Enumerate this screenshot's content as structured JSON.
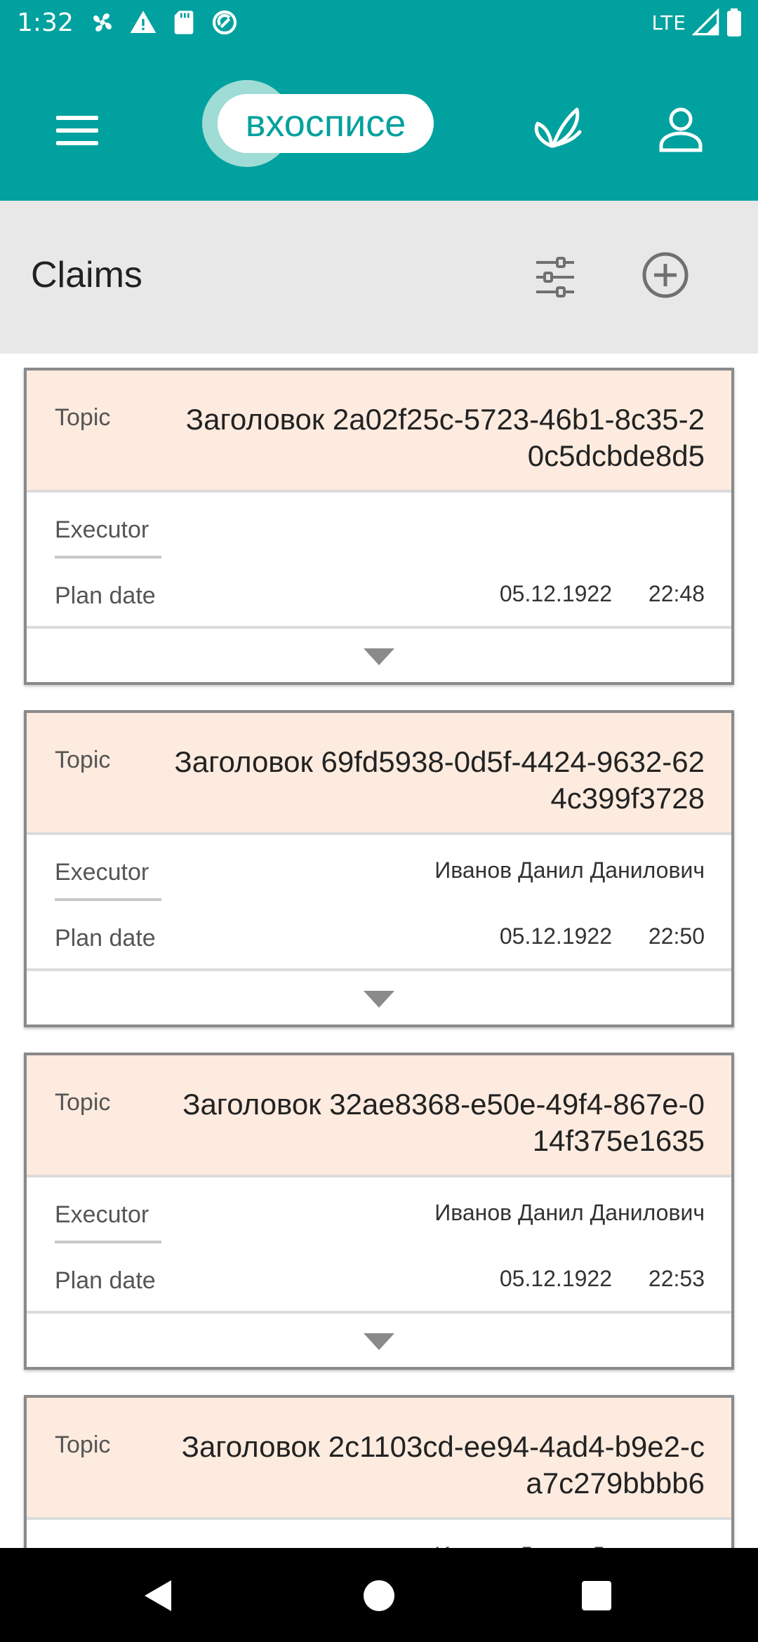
{
  "status_bar": {
    "time": "1:32",
    "network": "LTE",
    "icons": [
      "fan-icon",
      "warning-icon",
      "sd-card-icon",
      "sync-icon",
      "signal-icon",
      "battery-icon"
    ]
  },
  "app_bar": {
    "logo_text": "вхосписе",
    "icons": [
      "menu-icon",
      "butterfly-icon",
      "profile-icon"
    ],
    "accent_color": "#00A19E"
  },
  "section": {
    "title": "Claims",
    "icons": [
      "filter-icon",
      "add-circle-icon"
    ]
  },
  "labels": {
    "topic": "Topic",
    "executor": "Executor",
    "plan_date": "Plan date"
  },
  "claims": [
    {
      "topic": "Заголовок 2a02f25c-5723-46b1-8c35-20c5dcbde8d5",
      "executor": "",
      "date": "05.12.1922",
      "time": "22:48"
    },
    {
      "topic": "Заголовок 69fd5938-0d5f-4424-9632-624c399f3728",
      "executor": "Иванов Данил Данилович",
      "date": "05.12.1922",
      "time": "22:50"
    },
    {
      "topic": "Заголовок 32ae8368-e50e-49f4-867e-014f375e1635",
      "executor": "Иванов Данил Данилович",
      "date": "05.12.1922",
      "time": "22:53"
    },
    {
      "topic": "Заголовок 2c1103cd-ee94-4ad4-b9e2-ca7c279bbbb6",
      "executor": "Иванов Данил Данилович",
      "date": "",
      "time": ""
    }
  ],
  "nav_bar": {
    "icons": [
      "back-icon",
      "home-icon",
      "recents-icon"
    ]
  }
}
